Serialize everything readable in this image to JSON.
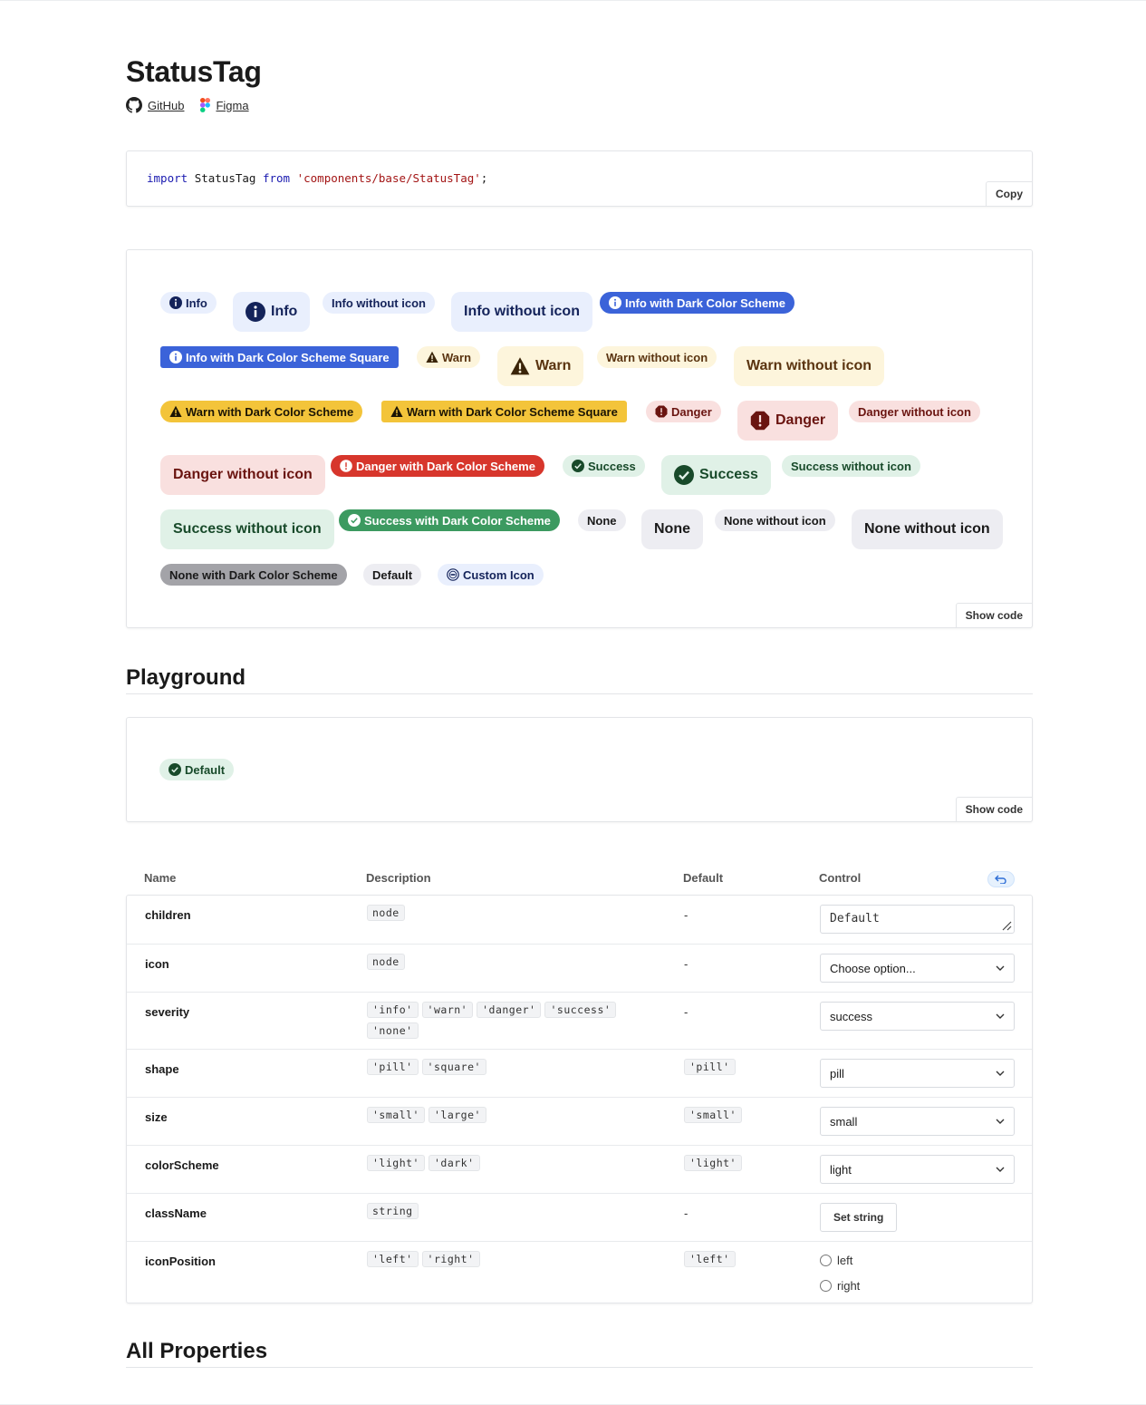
{
  "header": {
    "title": "StatusTag",
    "github_label": "GitHub",
    "figma_label": "Figma"
  },
  "import_code": {
    "kw_import": "import",
    "ident": "StatusTag",
    "kw_from": "from",
    "path": "'components/base/StatusTag'",
    "semi": ";",
    "copy_label": "Copy"
  },
  "demo": {
    "show_code_label": "Show code",
    "tags": {
      "info_s": "Info",
      "info_l": "Info",
      "info_noicon_s": "Info without icon",
      "info_noicon_l": "Info without icon",
      "info_dark": "Info with Dark Color Scheme",
      "info_dark_sq": "Info with Dark Color Scheme Square",
      "warn_s": "Warn",
      "warn_l": "Warn",
      "warn_noicon_s": "Warn without icon",
      "warn_noicon_l": "Warn without icon",
      "warn_dark": "Warn with Dark Color Scheme",
      "warn_dark_sq": "Warn with Dark Color Scheme Square",
      "danger_s": "Danger",
      "danger_l": "Danger",
      "danger_noicon_s": "Danger without icon",
      "danger_noicon_l": "Danger without icon",
      "danger_dark": "Danger with Dark Color Scheme",
      "success_s": "Success",
      "success_l": "Success",
      "success_noicon_s": "Success without icon",
      "success_noicon_l": "Success without icon",
      "success_dark": "Success with Dark Color Scheme",
      "none_s": "None",
      "none_l": "None",
      "none_noicon_s": "None without icon",
      "none_noicon_l": "None without icon",
      "none_dark": "None with Dark Color Scheme",
      "default": "Default",
      "custom_icon": "Custom Icon"
    }
  },
  "playground": {
    "heading": "Playground",
    "tag_label": "Default",
    "show_code_label": "Show code"
  },
  "props_table": {
    "headers": {
      "name": "Name",
      "description": "Description",
      "default": "Default",
      "control": "Control"
    },
    "rows": [
      {
        "name": "children",
        "desc": [
          "node"
        ],
        "default": "-",
        "control_value": "Default"
      },
      {
        "name": "icon",
        "desc": [
          "node"
        ],
        "default": "-",
        "control_value": "Choose option..."
      },
      {
        "name": "severity",
        "desc": [
          "'info'",
          "'warn'",
          "'danger'",
          "'success'",
          "'none'"
        ],
        "default": "-",
        "control_value": "success"
      },
      {
        "name": "shape",
        "desc": [
          "'pill'",
          "'square'"
        ],
        "default": "'pill'",
        "control_value": "pill"
      },
      {
        "name": "size",
        "desc": [
          "'small'",
          "'large'"
        ],
        "default": "'small'",
        "control_value": "small"
      },
      {
        "name": "colorScheme",
        "desc": [
          "'light'",
          "'dark'"
        ],
        "default": "'light'",
        "control_value": "light"
      },
      {
        "name": "className",
        "desc": [
          "string"
        ],
        "default": "-",
        "control_value": "Set string"
      },
      {
        "name": "iconPosition",
        "desc": [
          "'left'",
          "'right'"
        ],
        "default": "'left'",
        "radio_options": [
          "left",
          "right"
        ]
      }
    ]
  },
  "all_properties": {
    "heading": "All Properties"
  },
  "colors": {
    "info_light_bg": "#e9effd",
    "info_dark_bg": "#3b63d9",
    "warn_light_bg": "#fdf5dc",
    "warn_dark_bg": "#f3c43a",
    "danger_light_bg": "#f9e0df",
    "danger_dark_bg": "#d7362c",
    "success_light_bg": "#e0f1e7",
    "success_dark_bg": "#3c9a60",
    "none_light_bg": "#ededf2",
    "none_dark_bg": "#a3a3a8"
  },
  "icons": {
    "info": "info-circle-icon",
    "warn": "warning-triangle-icon",
    "danger": "exclamation-octagon-icon",
    "success": "check-circle-icon",
    "custom": "custom-badge-icon",
    "github": "github-icon",
    "figma": "figma-icon",
    "chevron": "chevron-down-icon",
    "reset": "undo-icon"
  }
}
